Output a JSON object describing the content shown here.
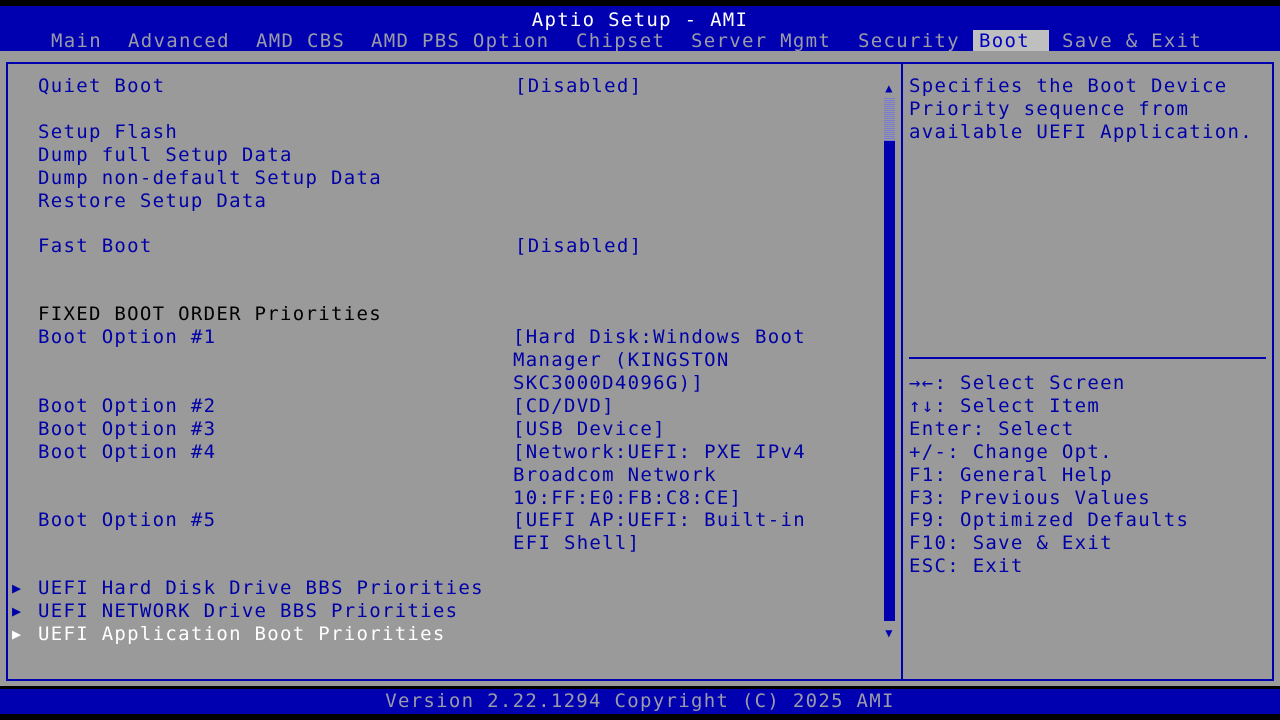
{
  "app_title": "Aptio Setup - AMI",
  "tabs": [
    {
      "label": "Main"
    },
    {
      "label": "Advanced"
    },
    {
      "label": "AMD CBS"
    },
    {
      "label": "AMD PBS Option"
    },
    {
      "label": "Chipset"
    },
    {
      "label": "Server Mgmt"
    },
    {
      "label": "Security"
    },
    {
      "label": "Boot"
    },
    {
      "label": "Save & Exit"
    }
  ],
  "active_tab": "Boot",
  "settings": {
    "quiet_boot": {
      "label": "Quiet Boot",
      "value": "[Disabled]"
    },
    "setup_flash": "Setup Flash",
    "dump_full": "Dump full Setup Data",
    "dump_non_default": "Dump non-default Setup Data",
    "restore_setup": "Restore Setup Data",
    "fast_boot": {
      "label": "Fast Boot",
      "value": "[Disabled]"
    },
    "fixed_boot_order_heading": "FIXED BOOT ORDER Priorities",
    "boot_options": [
      {
        "label": "Boot Option #1",
        "value_lines": [
          "[Hard Disk:Windows Boot",
          "Manager (KINGSTON",
          "SKC3000D4096G)]"
        ]
      },
      {
        "label": "Boot Option #2",
        "value_lines": [
          "[CD/DVD]"
        ]
      },
      {
        "label": "Boot Option #3",
        "value_lines": [
          "[USB Device]"
        ]
      },
      {
        "label": "Boot Option #4",
        "value_lines": [
          "[Network:UEFI: PXE IPv4",
          "Broadcom Network",
          "10:FF:E0:FB:C8:CE]"
        ]
      },
      {
        "label": "Boot Option #5",
        "value_lines": [
          "[UEFI AP:UEFI: Built-in",
          "EFI Shell]"
        ]
      }
    ],
    "submenus": [
      {
        "label": "UEFI Hard Disk Drive BBS Priorities"
      },
      {
        "label": "UEFI NETWORK Drive BBS Priorities"
      },
      {
        "label": "UEFI Application Boot Priorities",
        "selected": true
      }
    ]
  },
  "help_text": [
    "Specifies the Boot Device",
    "Priority sequence from",
    "available UEFI Application."
  ],
  "key_help": [
    "→←: Select Screen",
    "↑↓: Select Item",
    "Enter: Select",
    "+/-: Change Opt.",
    "F1: General Help",
    "F3: Previous Values",
    "F9: Optimized Defaults",
    "F10: Save & Exit",
    "ESC: Exit"
  ],
  "submenu_arrow_glyph": "▶",
  "scroll_up_glyph": "▲",
  "scroll_down_glyph": "▼",
  "version": "Version 2.22.1294 Copyright (C) 2025 AMI",
  "colors": {
    "background": "#9a9a9a",
    "accent_blue": "#0000b0",
    "active_tab_bg": "#bfbfbf",
    "selected_text": "#ffffff"
  }
}
